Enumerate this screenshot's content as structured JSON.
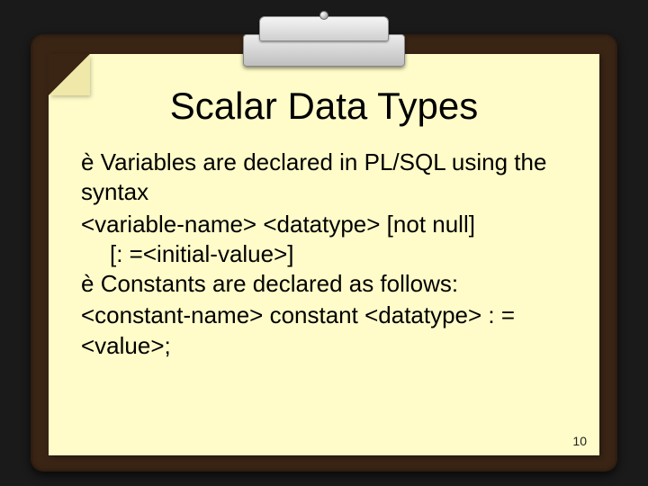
{
  "title": "Scalar Data Types",
  "bullets": {
    "b1_marker": "è",
    "b1_text": "Variables are declared in PL/SQL using the syntax",
    "b1_code1": "<variable-name> <datatype> [not null]",
    "b1_code2": "[: =<initial-value>]",
    "b2_marker": "è",
    "b2_text": " Constants are declared as follows:",
    "b2_code1": "<constant-name> constant <datatype> : = <value>;"
  },
  "page_number": "10"
}
